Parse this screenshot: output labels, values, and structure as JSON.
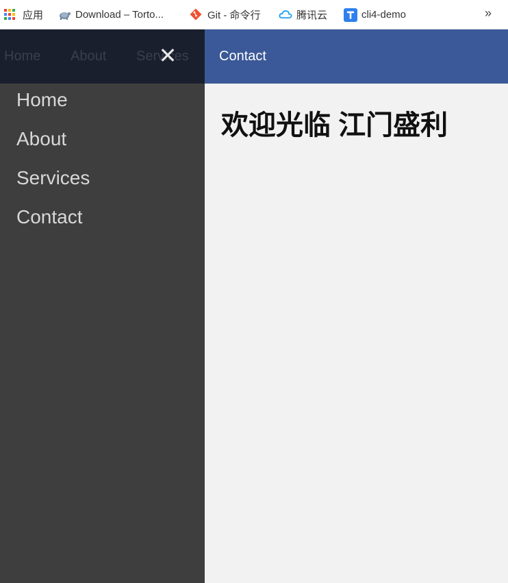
{
  "bookmarks": {
    "apps_label": "应用",
    "download_label": "Download – Torto...",
    "git_label": "Git - 命令行",
    "tencent_label": "腾讯云",
    "cli_label": "cli4-demo",
    "more_label": "»"
  },
  "nav": {
    "home": "Home",
    "about": "About",
    "services": "Services",
    "contact": "Contact",
    "close_glyph": "✕",
    "brand_color": "#3b5998"
  },
  "sidenav": {
    "items": [
      {
        "label": "Home"
      },
      {
        "label": "About"
      },
      {
        "label": "Services"
      },
      {
        "label": "Contact"
      }
    ]
  },
  "main": {
    "heading": "欢迎光临 江门盛利"
  }
}
